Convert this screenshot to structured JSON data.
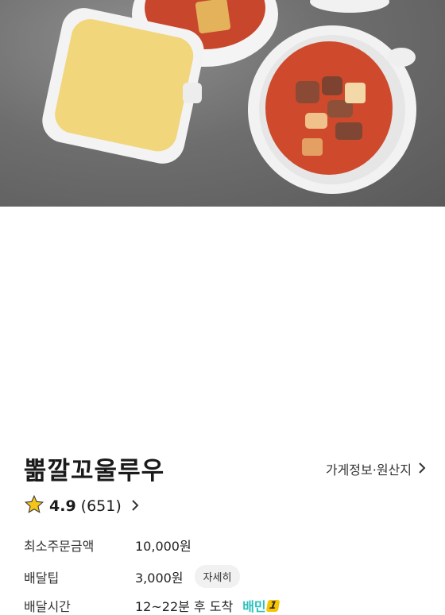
{
  "store": {
    "name": "뽊깔꼬울루우",
    "info_link": "가게정보·원산지"
  },
  "rating": {
    "score": "4.9",
    "count": "(651)"
  },
  "details": {
    "min_order": {
      "label": "최소주문금액",
      "value": "10,000원"
    },
    "delivery_tip": {
      "label": "배달팁",
      "value": "3,000원",
      "button": "자세히"
    },
    "delivery_time": {
      "label": "배달시간",
      "value": "12~22분 후 도착",
      "badge": "배민",
      "badge_num": "1"
    }
  },
  "colors": {
    "star": "#f5c518",
    "baemin": "#2ac1bc",
    "badge_bg": "#f7c600"
  }
}
